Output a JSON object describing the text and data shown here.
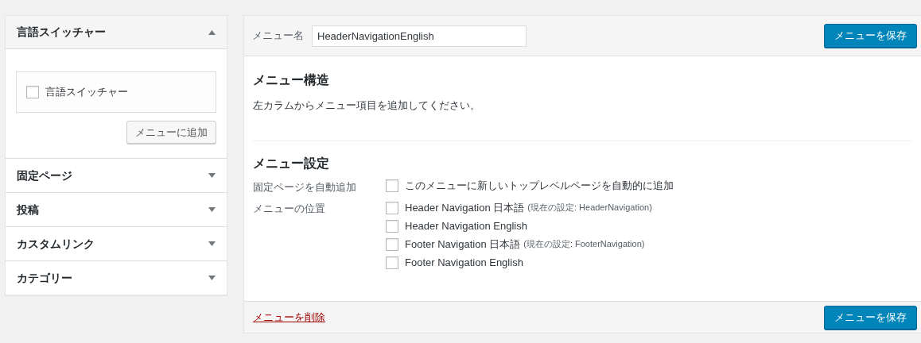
{
  "sidebar": {
    "sections": [
      {
        "title": "言語スイッチャー",
        "expanded": true,
        "items": [
          {
            "label": "言語スイッチャー",
            "checked": false
          }
        ],
        "button": "メニューに追加"
      },
      {
        "title": "固定ページ",
        "expanded": false
      },
      {
        "title": "投稿",
        "expanded": false
      },
      {
        "title": "カスタムリンク",
        "expanded": false
      },
      {
        "title": "カテゴリー",
        "expanded": false
      }
    ]
  },
  "menu_name": {
    "label": "メニュー名",
    "value": "HeaderNavigationEnglish"
  },
  "save_button": "メニューを保存",
  "structure": {
    "heading": "メニュー構造",
    "text": "左カラムからメニュー項目を追加してください。"
  },
  "settings": {
    "heading": "メニュー設定",
    "rows": [
      {
        "label": "固定ページを自動追加",
        "options": [
          {
            "label": "このメニューに新しいトップレベルページを自動的に追加",
            "checked": false
          }
        ]
      },
      {
        "label": "メニューの位置",
        "options": [
          {
            "label": "Header Navigation 日本語",
            "note": "(現在の設定: HeaderNavigation)",
            "checked": false
          },
          {
            "label": "Header Navigation English",
            "checked": false
          },
          {
            "label": "Footer Navigation 日本語",
            "note": "(現在の設定: FooterNavigation)",
            "checked": false
          },
          {
            "label": "Footer Navigation English",
            "checked": false
          }
        ]
      }
    ]
  },
  "footer": {
    "delete_link": "メニューを削除",
    "save_button": "メニューを保存"
  }
}
